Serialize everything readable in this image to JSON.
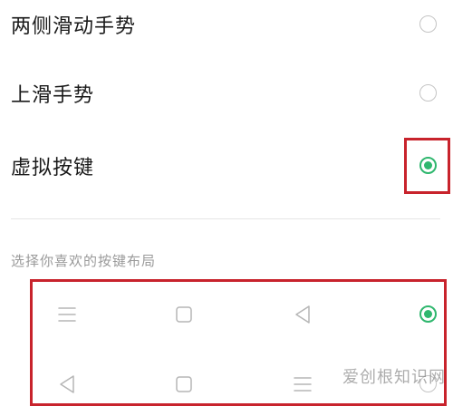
{
  "options": [
    {
      "label": "两侧滑动手势",
      "selected": false
    },
    {
      "label": "上滑手势",
      "selected": false
    },
    {
      "label": "虚拟按键",
      "selected": true
    }
  ],
  "section_header": "选择你喜欢的按键布局",
  "layouts": [
    {
      "icons": [
        "menu-icon",
        "square-icon",
        "back-triangle-icon"
      ],
      "selected": true
    },
    {
      "icons": [
        "back-triangle-icon",
        "square-icon",
        "menu-icon"
      ],
      "selected": false
    }
  ],
  "colors": {
    "accent": "#2fb76e",
    "highlight": "#c8232c"
  },
  "watermark": "爱创根知识网"
}
